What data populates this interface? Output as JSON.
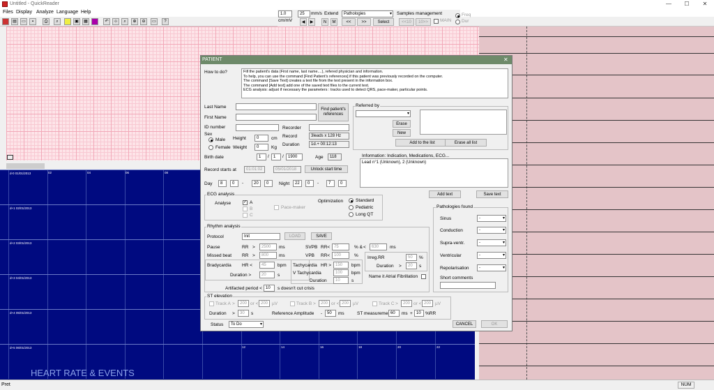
{
  "window": {
    "title": "Untitled - QuickReader",
    "minimize": "—",
    "maximize": "☐",
    "close": "✕"
  },
  "menu": [
    "Files",
    "Display",
    "Analyze",
    "Language",
    "Help"
  ],
  "toolbar": {
    "zoom_value": "1.0",
    "zoom_unit": "cm/mV",
    "speed_value": "25",
    "speed_unit": "mm/s",
    "extend_label": "Extend",
    "n_label": "N",
    "m_label": "M",
    "prev_label": "<<",
    "next_label": ">>",
    "pathologies_value": "Pathologies",
    "select_all_label": "Select ALL",
    "samples_management_label": "Samples management",
    "prev10_label": "<<10",
    "next10_label": "10>>",
    "main_label": "MAIN",
    "freq_label": "Freq",
    "dur_label": "Dur"
  },
  "events": {
    "title": "HEART RATE & EVENTS",
    "rows": [
      "d-0  01/01/2013",
      "d+1  02/01/2013",
      "d+2  03/01/2013",
      "d+3  04/01/2013",
      "d+4  05/01/2013",
      "d+5  06/01/2013"
    ],
    "ticks": [
      "02",
      "04",
      "06",
      "08",
      "10",
      "12",
      "14",
      "16",
      "18",
      "20",
      "22"
    ]
  },
  "status": {
    "left": "Pret",
    "num": "NUM"
  },
  "dialog": {
    "title": "PATIENT",
    "close_label": "✕",
    "how_label": "How to do?",
    "help_lines": [
      "Fill the patient's data (First name, last name....), refered physician and information.",
      "To help, you can use the command [Find Patient's references] if this patient was previously recorded on the computer.",
      "The command [Save Text] creates a text file from the text present in the information box.",
      "The command [Add text] add one of the saved text files to the current text.",
      "ECG analysis: adjust if necessary the parameters : tracks used to detect QRS, pace-maker, particular points."
    ],
    "last_name_label": "Last Name",
    "first_name_label": "First Name",
    "id_label": "ID number",
    "find_refs_label": "Find patient's references",
    "recorder_label": "Recorder",
    "record_label": "Record",
    "record_value": "3leads x 128 Hz",
    "duration_label": "Duration",
    "duration_value": "1d.+ 00:12:13",
    "sex_label": "Sex",
    "male_label": "Male",
    "female_label": "Female",
    "height_label": "Height",
    "height_value": "0",
    "height_unit": "cm",
    "weight_label": "Weight",
    "weight_value": "0",
    "weight_unit": "Kg",
    "birth_label": "Birth date",
    "birth_day": "1",
    "birth_month": "1",
    "birth_year": "1900",
    "age_label": "Age",
    "age_value": "118",
    "record_starts_label": "Record starts at",
    "record_time": "01:01:02",
    "record_date": "05/01/2018",
    "unlock_label": "Unlock start time",
    "day_label": "Day",
    "day_h1": "8",
    "day_m1": "0",
    "day_h2": "20",
    "day_m2": "0",
    "night_label": "Night",
    "night_h1": "22",
    "night_m1": "0",
    "night_h2": "7",
    "night_m2": "0",
    "referred_label": "Referred by",
    "erase_label": "Erase",
    "new_label": "New",
    "add_list_label": "Add to the list",
    "erase_all_label": "Erase all list",
    "info_label": "Information: Indication, Medications, ECG...",
    "info_text": "Lead n°1 (Unknown), 2 (Unknown)",
    "add_text_label": "Add text",
    "save_text_label": "Save text",
    "ecg_label": "ECG analysis",
    "analyse_label": "Analyse",
    "track_a": "A",
    "track_b": "B",
    "track_c": "C",
    "pacemaker_label": "Pace-maker",
    "optimization_label": "Optimization",
    "opt_standard": "Standard",
    "opt_pediatric": "Pediatric",
    "opt_longqt": "Long QT",
    "rhythm_label": "Rhythm analysis",
    "protocol_label": "Protocol",
    "protocol_value": "Init",
    "load_label": "LOAD",
    "save_label": "SAVE",
    "pause_label": "Pause",
    "pause_rr": "RR",
    "pause_value": "2500",
    "ms": "ms",
    "missed_label": "Missed beat",
    "missed_rr": "RR",
    "missed_value": "800",
    "svpb_label": "SVPB",
    "svpb_rr": "RR<",
    "svpb_value": "75",
    "pct_and": "% &",
    "lt": "<",
    "svpb_ms_value": "630",
    "vpb_label": "VPB",
    "vpb_rr": "RR<",
    "vpb_value": "100",
    "pct": "%",
    "brady_label": "Bradycardia",
    "hr_lt": "HR  <",
    "brady_value": "45",
    "bpm": "bpm",
    "dur_gt": "Duration   >",
    "brady_dur": "20",
    "s": "s",
    "tachy_label": "Tachycardia",
    "hr_gt": "HR  >",
    "tachy_value": "150",
    "vtachy_label": "V Tachycardia",
    "vtachy_value": "100",
    "dur_label_short": "Duration",
    "vtachy_dur": "10",
    "irreg_label": "Irreg.RR",
    "irreg_value": "50",
    "irreg_dur_label": "Duration",
    "irreg_dur": "20",
    "af_label": "Name it Atrial Fibrillation",
    "artifacted_label": "Artifacted period <",
    "artifacted_value": "10",
    "artifacted_tail": "s    doesn't cut crisis",
    "st_label": "ST elevation",
    "track_a_lbl": "Track A",
    "track_b_lbl": "Track B",
    "track_c_lbl": "Track C",
    "st_val1": "200",
    "st_val2": "200",
    "uv": "µV",
    "st_dur_label": "Duration",
    "st_dur": "30",
    "ref_amp_label": "Reference Amplitude",
    "ref_amp": "50",
    "st_meas_label": "ST measurement",
    "st_meas": "60",
    "plus": "+",
    "st_pct": "10",
    "pct_rr": "%RR",
    "patho_label": "Pathologies found",
    "patho_items": [
      "Sinus",
      "Conduction",
      "Supra-ventr.",
      "Ventricular",
      "Repolarisation"
    ],
    "patho_value": "-",
    "short_comments_label": "Short comments",
    "status_label": "Status",
    "status_value": "To Do",
    "cancel_label": "CANCEL",
    "ok_label": "OK"
  }
}
